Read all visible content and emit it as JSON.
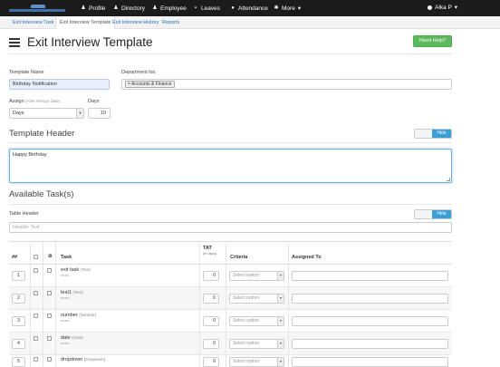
{
  "colors": {
    "topbar": "#1b1b1b",
    "link": "#2a6ebb",
    "help": "#5cb85c",
    "toggle_on": "#3a9fd6"
  },
  "nav": {
    "items": [
      {
        "label": "Profile",
        "icon": "person-icon"
      },
      {
        "label": "Directory",
        "icon": "people-icon"
      },
      {
        "label": "Employee",
        "icon": "person-icon"
      },
      {
        "label": "Leaves",
        "icon": "suitcase-icon"
      },
      {
        "label": "Attendance",
        "icon": "clock-icon"
      },
      {
        "label": "More",
        "icon": "gear-icon"
      }
    ],
    "user": "Alka P"
  },
  "subnav": [
    "Exit Interview Task",
    "Exit Interview Template",
    "Exit Interview History",
    "Reports"
  ],
  "page": {
    "title": "Exit Interview Template",
    "help": "Need Help?"
  },
  "form": {
    "template_name_label": "Template Name",
    "template_name_value": "Birthday Notification",
    "dept_label": "Department list",
    "dept_tag": "× Accounts & Finance",
    "assign_label": "Assign",
    "assign_hint": "(After Resign Date)",
    "assign_value": "Days",
    "days_label": "Days",
    "days_value": "10"
  },
  "header_section": {
    "title": "Template Header",
    "toggle": "Hide",
    "text": "Happy Birthday"
  },
  "tasks_section": {
    "title": "Available Task(s)",
    "table_header_label": "Table Header",
    "table_header_placeholder": "Header Text",
    "toggle": "Hide"
  },
  "table": {
    "columns": {
      "num": "##",
      "task": "Task",
      "tat": "TAT",
      "tat_sub": "(in days)",
      "criteria": "Criteria",
      "assigned": "Assigned To"
    },
    "rows": [
      {
        "num": "1",
        "name": "exit task",
        "type": "(Text)",
        "more": "more...",
        "tat": "0",
        "criteria": "Select option"
      },
      {
        "num": "2",
        "name": "test1",
        "type": "(Text)",
        "more": "more...",
        "tat": "0",
        "criteria": "Select option"
      },
      {
        "num": "3",
        "name": "number",
        "type": "(Number)",
        "more": "more...",
        "tat": "0",
        "criteria": "Select option"
      },
      {
        "num": "4",
        "name": "date",
        "type": "(Date)",
        "more": "more...",
        "tat": "0",
        "criteria": "Select option"
      },
      {
        "num": "5",
        "name": "dropdown",
        "type": "(Dropdown)",
        "more": "",
        "tat": "0",
        "criteria": "Select option"
      }
    ]
  }
}
